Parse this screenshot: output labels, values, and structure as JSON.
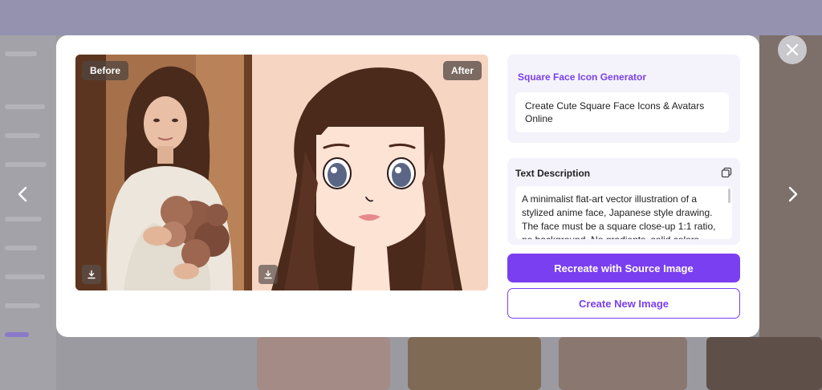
{
  "modal": {
    "before_label": "Before",
    "after_label": "After",
    "tool_name": "Square Face Icon Generator",
    "tool_subtitle": "Create Cute Square Face Icons & Avatars Online",
    "description_label": "Text Description",
    "description_text": "A minimalist flat-art vector illustration of a stylized anime face, Japanese style drawing. The face must be a square close-up 1:1 ratio, no background. No gradients, solid colors only.",
    "recreate_button": "Recreate with Source Image",
    "create_new_button": "Create New Image"
  },
  "icons": {
    "close": "close-icon",
    "prev": "chevron-left-icon",
    "next": "chevron-right-icon",
    "download": "download-icon",
    "copy": "copy-icon"
  },
  "colors": {
    "accent": "#7a3ff0",
    "after_background": "#f7d5c3",
    "panel_background": "#f4f3fb"
  }
}
